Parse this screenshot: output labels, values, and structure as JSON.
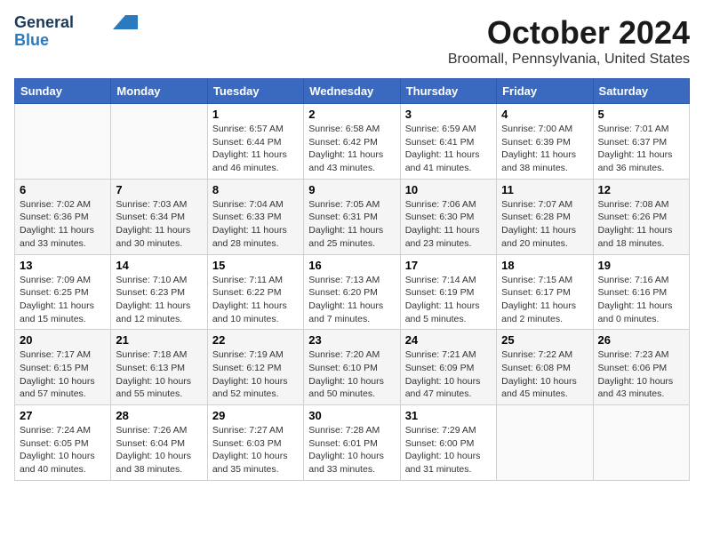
{
  "header": {
    "logo_line1": "General",
    "logo_line2": "Blue",
    "month": "October 2024",
    "location": "Broomall, Pennsylvania, United States"
  },
  "days_of_week": [
    "Sunday",
    "Monday",
    "Tuesday",
    "Wednesday",
    "Thursday",
    "Friday",
    "Saturday"
  ],
  "weeks": [
    [
      {
        "num": "",
        "info": ""
      },
      {
        "num": "",
        "info": ""
      },
      {
        "num": "1",
        "info": "Sunrise: 6:57 AM\nSunset: 6:44 PM\nDaylight: 11 hours and 46 minutes."
      },
      {
        "num": "2",
        "info": "Sunrise: 6:58 AM\nSunset: 6:42 PM\nDaylight: 11 hours and 43 minutes."
      },
      {
        "num": "3",
        "info": "Sunrise: 6:59 AM\nSunset: 6:41 PM\nDaylight: 11 hours and 41 minutes."
      },
      {
        "num": "4",
        "info": "Sunrise: 7:00 AM\nSunset: 6:39 PM\nDaylight: 11 hours and 38 minutes."
      },
      {
        "num": "5",
        "info": "Sunrise: 7:01 AM\nSunset: 6:37 PM\nDaylight: 11 hours and 36 minutes."
      }
    ],
    [
      {
        "num": "6",
        "info": "Sunrise: 7:02 AM\nSunset: 6:36 PM\nDaylight: 11 hours and 33 minutes."
      },
      {
        "num": "7",
        "info": "Sunrise: 7:03 AM\nSunset: 6:34 PM\nDaylight: 11 hours and 30 minutes."
      },
      {
        "num": "8",
        "info": "Sunrise: 7:04 AM\nSunset: 6:33 PM\nDaylight: 11 hours and 28 minutes."
      },
      {
        "num": "9",
        "info": "Sunrise: 7:05 AM\nSunset: 6:31 PM\nDaylight: 11 hours and 25 minutes."
      },
      {
        "num": "10",
        "info": "Sunrise: 7:06 AM\nSunset: 6:30 PM\nDaylight: 11 hours and 23 minutes."
      },
      {
        "num": "11",
        "info": "Sunrise: 7:07 AM\nSunset: 6:28 PM\nDaylight: 11 hours and 20 minutes."
      },
      {
        "num": "12",
        "info": "Sunrise: 7:08 AM\nSunset: 6:26 PM\nDaylight: 11 hours and 18 minutes."
      }
    ],
    [
      {
        "num": "13",
        "info": "Sunrise: 7:09 AM\nSunset: 6:25 PM\nDaylight: 11 hours and 15 minutes."
      },
      {
        "num": "14",
        "info": "Sunrise: 7:10 AM\nSunset: 6:23 PM\nDaylight: 11 hours and 12 minutes."
      },
      {
        "num": "15",
        "info": "Sunrise: 7:11 AM\nSunset: 6:22 PM\nDaylight: 11 hours and 10 minutes."
      },
      {
        "num": "16",
        "info": "Sunrise: 7:13 AM\nSunset: 6:20 PM\nDaylight: 11 hours and 7 minutes."
      },
      {
        "num": "17",
        "info": "Sunrise: 7:14 AM\nSunset: 6:19 PM\nDaylight: 11 hours and 5 minutes."
      },
      {
        "num": "18",
        "info": "Sunrise: 7:15 AM\nSunset: 6:17 PM\nDaylight: 11 hours and 2 minutes."
      },
      {
        "num": "19",
        "info": "Sunrise: 7:16 AM\nSunset: 6:16 PM\nDaylight: 11 hours and 0 minutes."
      }
    ],
    [
      {
        "num": "20",
        "info": "Sunrise: 7:17 AM\nSunset: 6:15 PM\nDaylight: 10 hours and 57 minutes."
      },
      {
        "num": "21",
        "info": "Sunrise: 7:18 AM\nSunset: 6:13 PM\nDaylight: 10 hours and 55 minutes."
      },
      {
        "num": "22",
        "info": "Sunrise: 7:19 AM\nSunset: 6:12 PM\nDaylight: 10 hours and 52 minutes."
      },
      {
        "num": "23",
        "info": "Sunrise: 7:20 AM\nSunset: 6:10 PM\nDaylight: 10 hours and 50 minutes."
      },
      {
        "num": "24",
        "info": "Sunrise: 7:21 AM\nSunset: 6:09 PM\nDaylight: 10 hours and 47 minutes."
      },
      {
        "num": "25",
        "info": "Sunrise: 7:22 AM\nSunset: 6:08 PM\nDaylight: 10 hours and 45 minutes."
      },
      {
        "num": "26",
        "info": "Sunrise: 7:23 AM\nSunset: 6:06 PM\nDaylight: 10 hours and 43 minutes."
      }
    ],
    [
      {
        "num": "27",
        "info": "Sunrise: 7:24 AM\nSunset: 6:05 PM\nDaylight: 10 hours and 40 minutes."
      },
      {
        "num": "28",
        "info": "Sunrise: 7:26 AM\nSunset: 6:04 PM\nDaylight: 10 hours and 38 minutes."
      },
      {
        "num": "29",
        "info": "Sunrise: 7:27 AM\nSunset: 6:03 PM\nDaylight: 10 hours and 35 minutes."
      },
      {
        "num": "30",
        "info": "Sunrise: 7:28 AM\nSunset: 6:01 PM\nDaylight: 10 hours and 33 minutes."
      },
      {
        "num": "31",
        "info": "Sunrise: 7:29 AM\nSunset: 6:00 PM\nDaylight: 10 hours and 31 minutes."
      },
      {
        "num": "",
        "info": ""
      },
      {
        "num": "",
        "info": ""
      }
    ]
  ]
}
